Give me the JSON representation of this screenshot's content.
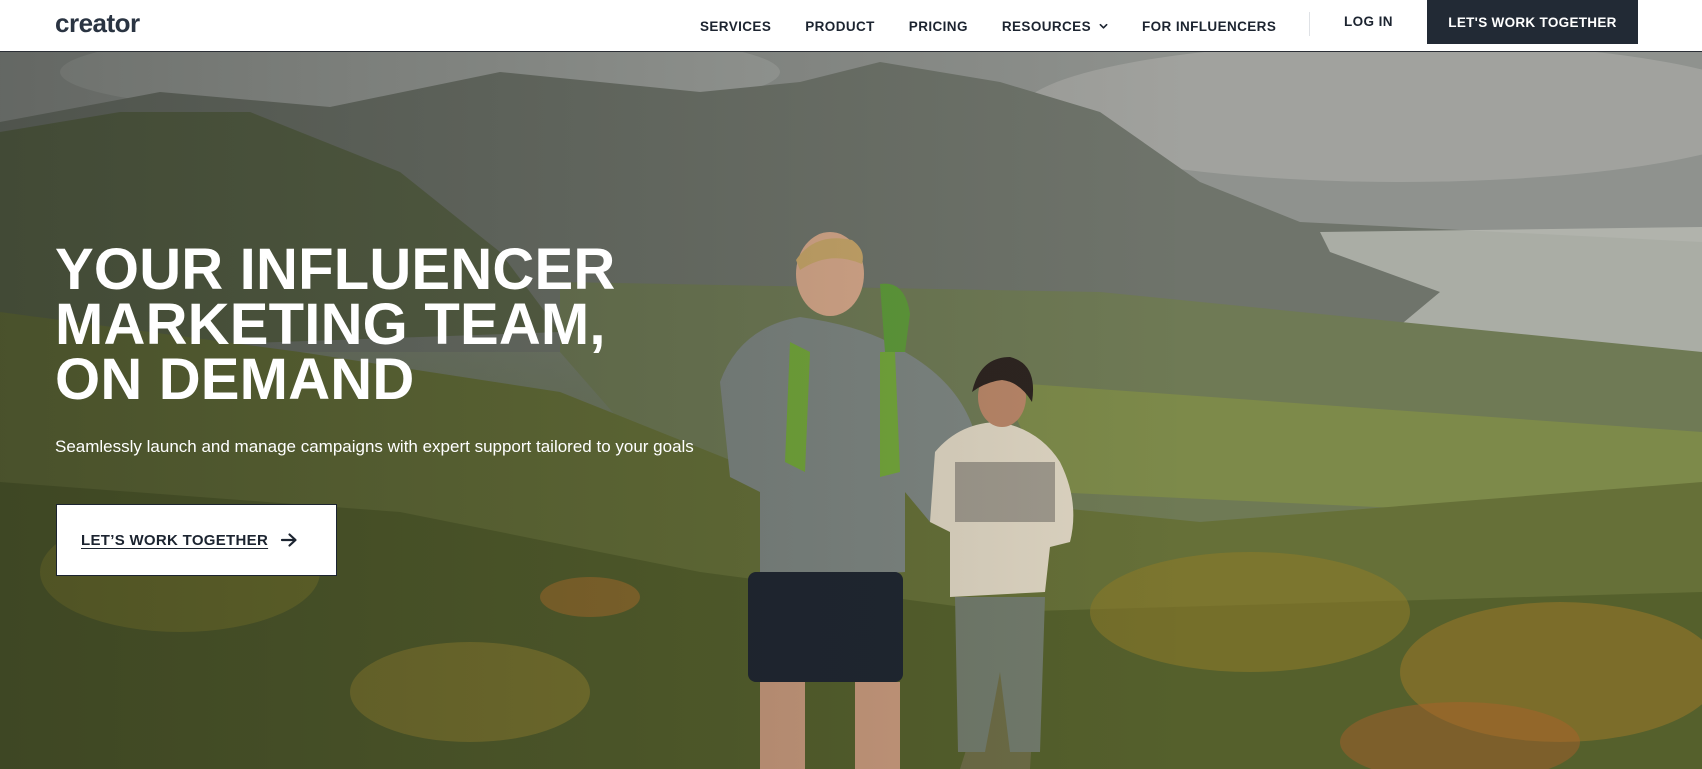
{
  "header": {
    "logo": "creator",
    "nav": [
      {
        "label": "SERVICES"
      },
      {
        "label": "PRODUCT"
      },
      {
        "label": "PRICING"
      },
      {
        "label": "RESOURCES",
        "icon": "chevron-down-icon"
      },
      {
        "label": "FOR INFLUENCERS"
      }
    ],
    "login_label": "LOG IN",
    "cta_label": "LET'S WORK TOGETHER"
  },
  "hero": {
    "headline": [
      "YOUR INFLUENCER",
      "MARKETING TEAM,",
      "ON DEMAND"
    ],
    "subhead": "Seamlessly launch and manage campaigns with expert support tailored to your goals",
    "cta_label": "LET’S WORK TOGETHER",
    "cta_icon": "arrow-right-icon",
    "background": "hikers-on-mountain-trail-photo"
  },
  "colors": {
    "cta_dark": "#222a35",
    "text_dark": "#1c2430",
    "white": "#ffffff"
  }
}
